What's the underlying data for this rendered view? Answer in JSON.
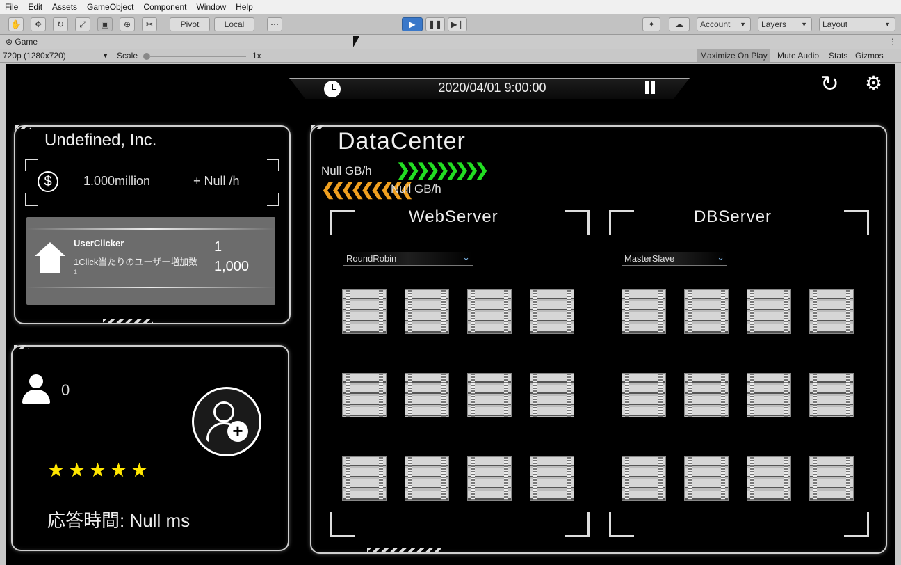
{
  "menu": [
    "File",
    "Edit",
    "Assets",
    "GameObject",
    "Component",
    "Window",
    "Help"
  ],
  "toolbar": {
    "pivot_label": "Pivot",
    "local_label": "Local",
    "account_label": "Account",
    "layers_label": "Layers",
    "layout_label": "Layout"
  },
  "tab": {
    "title": "Game"
  },
  "game_toolbar": {
    "resolution": "720p (1280x720)",
    "scale_label": "Scale",
    "scale_value": "1x",
    "maximize_label": "Maximize On Play",
    "mute_label": "Mute Audio",
    "stats_label": "Stats",
    "gizmos_label": "Gizmos"
  },
  "hud": {
    "datetime": "2020/04/01 9:00:00"
  },
  "company": {
    "name": "Undefined, Inc.",
    "money": "1.000million",
    "income": "+ Null /h"
  },
  "clicker": {
    "title": "UserClicker",
    "desc": "1Click当たりのユーザー増加数",
    "small": "1",
    "level": "1",
    "cost": "1,000"
  },
  "users": {
    "count": "0",
    "rating": 5,
    "response_label": "応答時間: Null ms"
  },
  "datacenter": {
    "title": "DataCenter",
    "inbound": "Null GB/h",
    "outbound": "Null GB/h",
    "colors": {
      "inbound": "#22dd22",
      "outbound": "#f0a020"
    }
  },
  "web": {
    "title": "WebServer",
    "mode": "RoundRobin"
  },
  "db": {
    "title": "DBServer",
    "mode": "MasterSlave"
  }
}
